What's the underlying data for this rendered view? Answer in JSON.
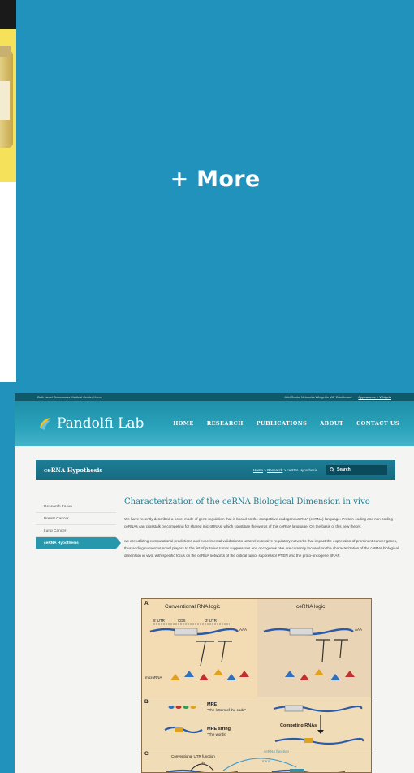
{
  "more_tile": {
    "label": "+ More",
    "color": "#2192bc"
  },
  "site": {
    "topbar": {
      "left": "Beth Israel Deaconess Medical Center Home",
      "right_1": "Add Social Networks Widget in WP Dashboard",
      "right_2": "Appearance > Widgets"
    },
    "logo_text": "Pandolfi Lab",
    "nav": [
      "HOME",
      "RESEARCH",
      "PUBLICATIONS",
      "ABOUT",
      "CONTACT US"
    ],
    "title_bar": {
      "title": "ceRNA Hypothesis",
      "crumb_home": "Home",
      "crumb_sep1": " > ",
      "crumb_research": "Research",
      "crumb_sep2": " > ",
      "crumb_current": "ceRNA Hypothesis",
      "search_label": "Search"
    },
    "sidebar": [
      {
        "label": "Research Focus"
      },
      {
        "label": "Breast Cancer"
      },
      {
        "label": "Lung Cancer"
      },
      {
        "label": "ceRNA Hypothesis"
      }
    ],
    "article": {
      "heading": "Characterization of the ceRNA Biological Dimension in vivo",
      "para1": "We have recently described a novel mode of gene regulation that is based on the competitive endogenous RNA (ceRNA) language. Protein-coding and non-coding ceRNAs can crosstalk by competing for shared microRNAs, which constitute the words of this ceRNA language. On the basis of this new theory,",
      "para2": "we are utilizing computational predictions and experimental validation to unravel extensive regulatory networks that impact the expression of prominent cancer genes, thus adding numerous novel players to the list of putative tumor suppressors and oncogenes. We are currently focused on the characterization of the ceRNA biological dimension in vivo, with specific focus on the ceRNA networks of the critical tumor suppressor PTEN and the proto-oncogene BRAF."
    },
    "figure": {
      "a_letter": "A",
      "a_left_title": "Conventional RNA logic",
      "a_right_title": "ceRNA logic",
      "utr5": "5' UTR",
      "cds": "CDS",
      "utr3": "3' UTR",
      "aaa": "AAA",
      "microrna": "microRNA",
      "b_letter": "B",
      "mre": "MRE",
      "mre_sub": "\"The letters of the code\"",
      "mre_string": "MRE string",
      "mre_string_sub": "\"The words\"",
      "competing": "Competing RNAs",
      "c_letter": "C",
      "c_title": "Conventional UTR function",
      "cis": "cis",
      "trans": "trans",
      "cerna_function": "ceRNA function"
    }
  }
}
